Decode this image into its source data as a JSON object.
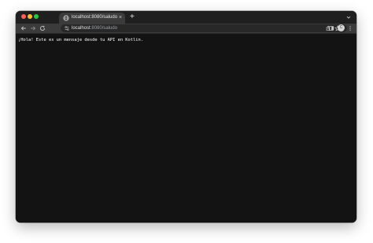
{
  "browser": {
    "tab_title": "localhost:8080/saludo",
    "tab_close_glyph": "×",
    "new_tab_glyph": "+",
    "url_host": "localhost",
    "url_rest": ":8080/saludo",
    "profile_initial": "C"
  },
  "icons": {
    "favicon": "globe-icon",
    "tab_search": "chevron-down-icon",
    "back": "back-arrow-icon",
    "forward": "forward-arrow-icon",
    "reload": "reload-icon",
    "site_info": "site-info-icon",
    "share": "share-icon",
    "bookmark": "star-icon",
    "side_panel": "side-panel-icon",
    "menu": "kebab-menu-icon"
  },
  "colors": {
    "window_close": "#fe5f57",
    "window_minimize": "#febc2e",
    "window_zoom": "#28c840",
    "page_background": "#131313",
    "page_text": "#ffffff"
  },
  "page": {
    "body_text": "¡Hola! Este es un mensaje desde tu API en Kotlin."
  }
}
